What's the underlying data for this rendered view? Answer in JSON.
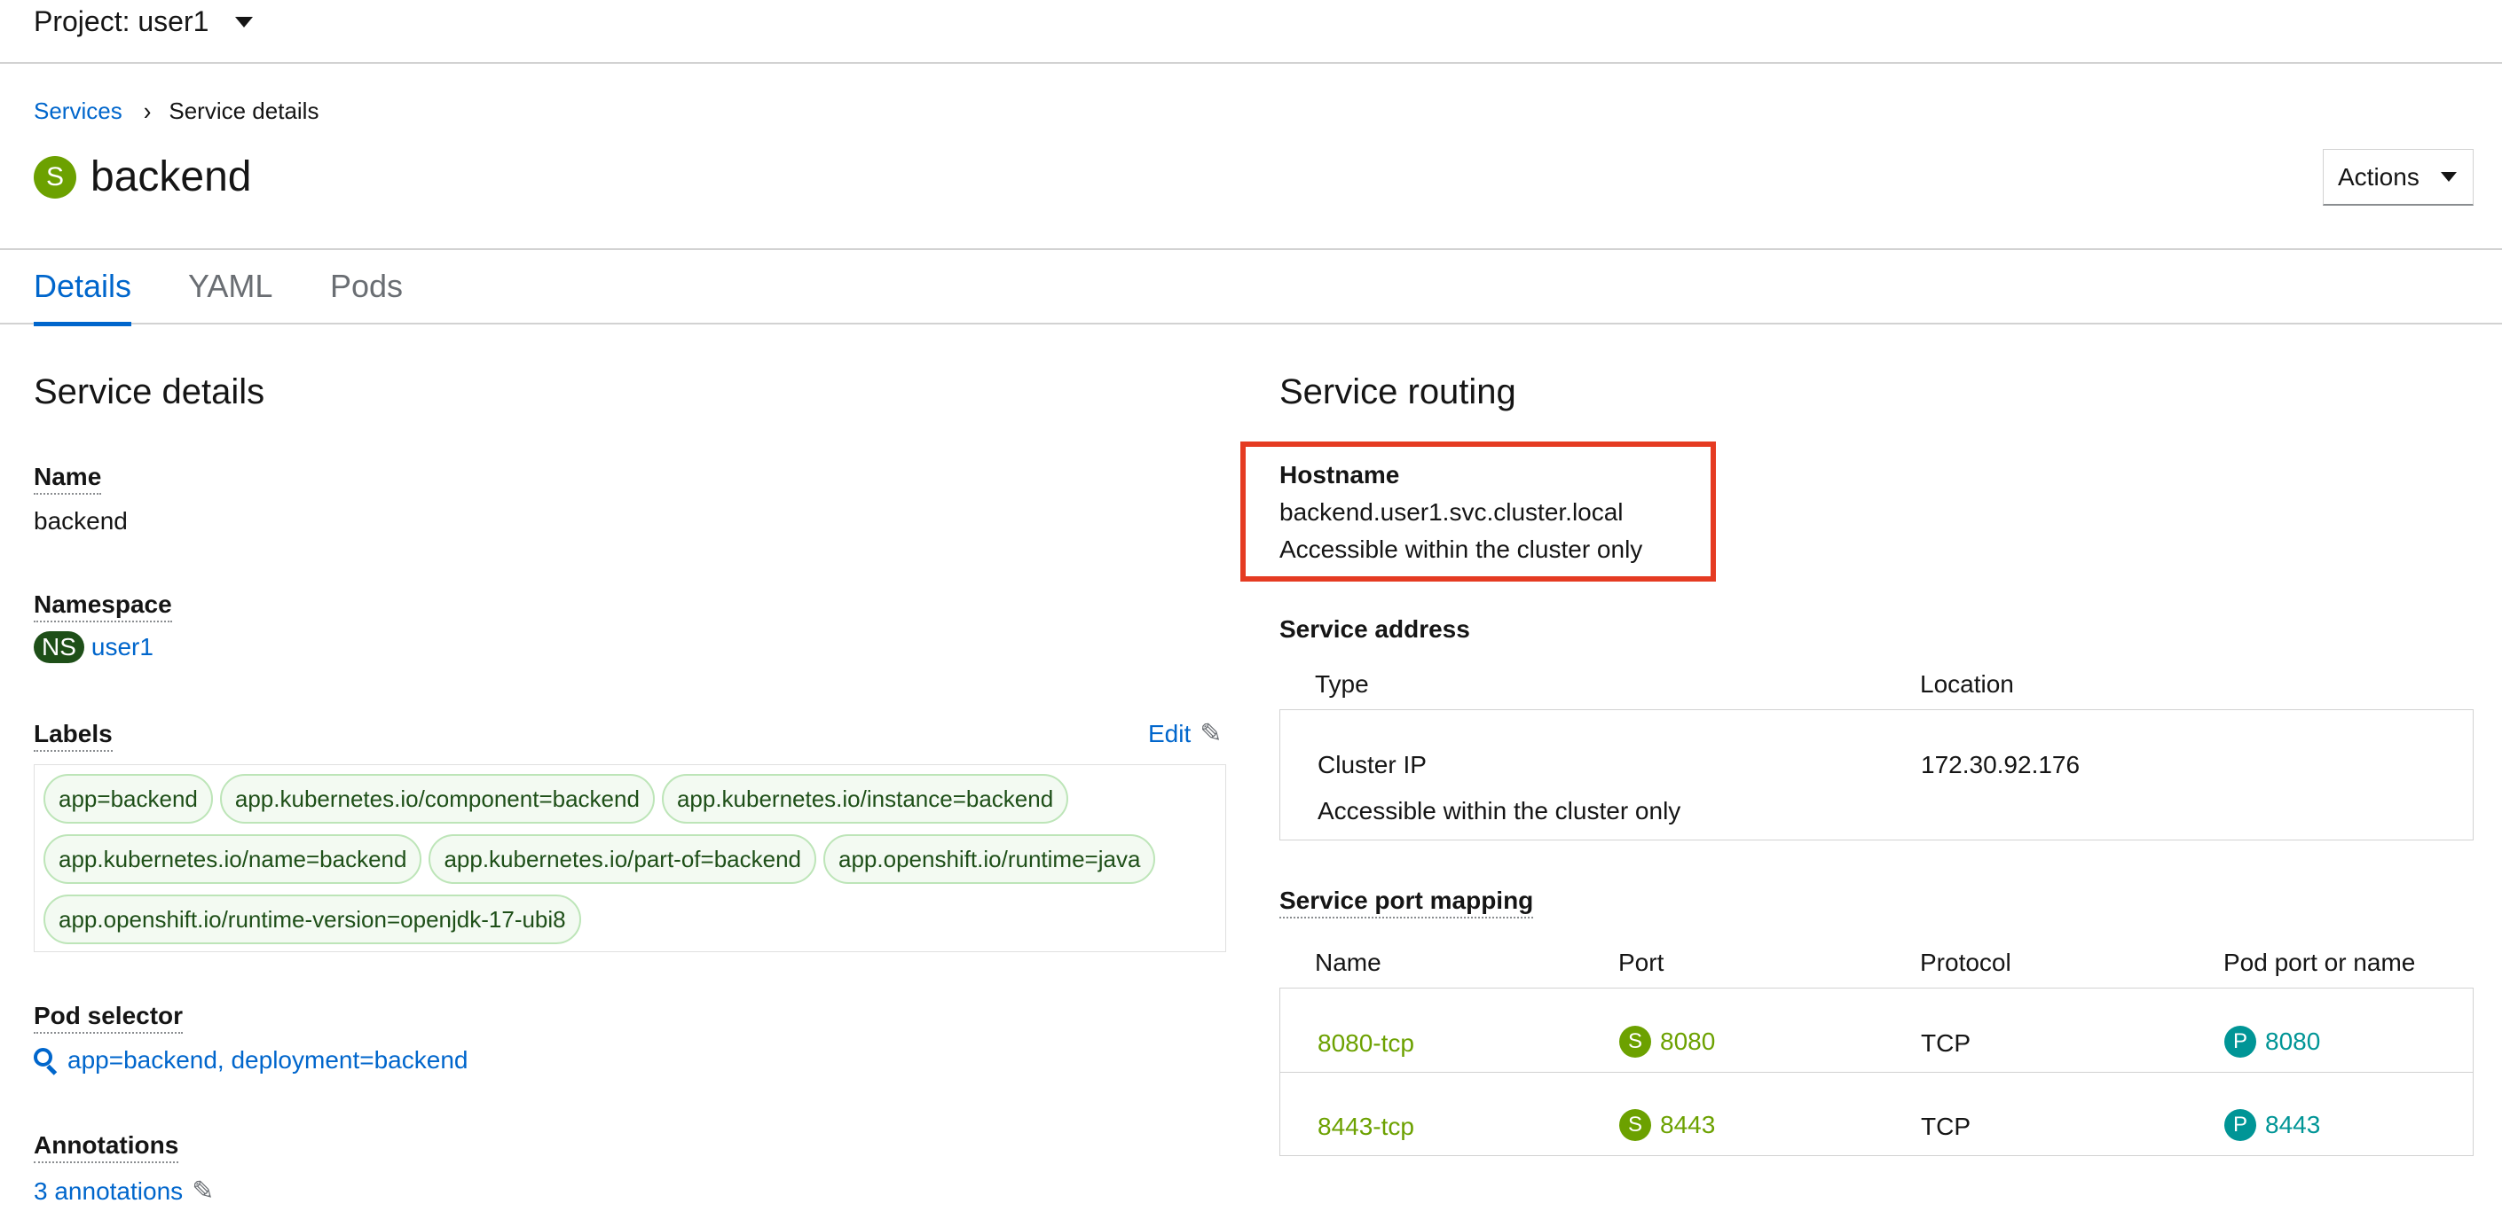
{
  "masthead": {
    "project_label": "Project: user1"
  },
  "breadcrumb": {
    "parent": "Services",
    "current": "Service details"
  },
  "header": {
    "kind_badge": "S",
    "title": "backend",
    "actions_label": "Actions"
  },
  "tabs": [
    {
      "label": "Details",
      "active": true
    },
    {
      "label": "YAML",
      "active": false
    },
    {
      "label": "Pods",
      "active": false
    }
  ],
  "service_details": {
    "heading": "Service details",
    "name_label": "Name",
    "name_value": "backend",
    "namespace_label": "Namespace",
    "namespace_badge": "NS",
    "namespace_value": "user1",
    "labels_label": "Labels",
    "edit_label": "Edit",
    "labels": [
      "app=backend",
      "app.kubernetes.io/component=backend",
      "app.kubernetes.io/instance=backend",
      "app.kubernetes.io/name=backend",
      "app.kubernetes.io/part-of=backend",
      "app.openshift.io/runtime=java",
      "app.openshift.io/runtime-version=openjdk-17-ubi8"
    ],
    "pod_selector_label": "Pod selector",
    "pod_selector_value": "app=backend, deployment=backend",
    "annotations_label": "Annotations",
    "annotations_value": "3 annotations"
  },
  "service_routing": {
    "heading": "Service routing",
    "hostname_label": "Hostname",
    "hostname_value": "backend.user1.svc.cluster.local",
    "hostname_note": "Accessible within the cluster only",
    "address_label": "Service address",
    "address_columns": {
      "type": "Type",
      "location": "Location"
    },
    "address_row": {
      "type": "Cluster IP",
      "type_note": "Accessible within the cluster only",
      "location": "172.30.92.176"
    },
    "port_mapping_label": "Service port mapping",
    "port_columns": {
      "name": "Name",
      "port": "Port",
      "protocol": "Protocol",
      "pod_port": "Pod port or name"
    },
    "port_badge_service": "S",
    "port_badge_pod": "P",
    "ports": [
      {
        "name": "8080-tcp",
        "port": "8080",
        "protocol": "TCP",
        "pod_port": "8080"
      },
      {
        "name": "8443-tcp",
        "port": "8443",
        "protocol": "TCP",
        "pod_port": "8443"
      }
    ]
  },
  "colors": {
    "link": "#0066cc",
    "service_badge": "#6ca100",
    "pod_badge": "#009596",
    "namespace_badge": "#1e4f18",
    "highlight": "#e53b22"
  }
}
